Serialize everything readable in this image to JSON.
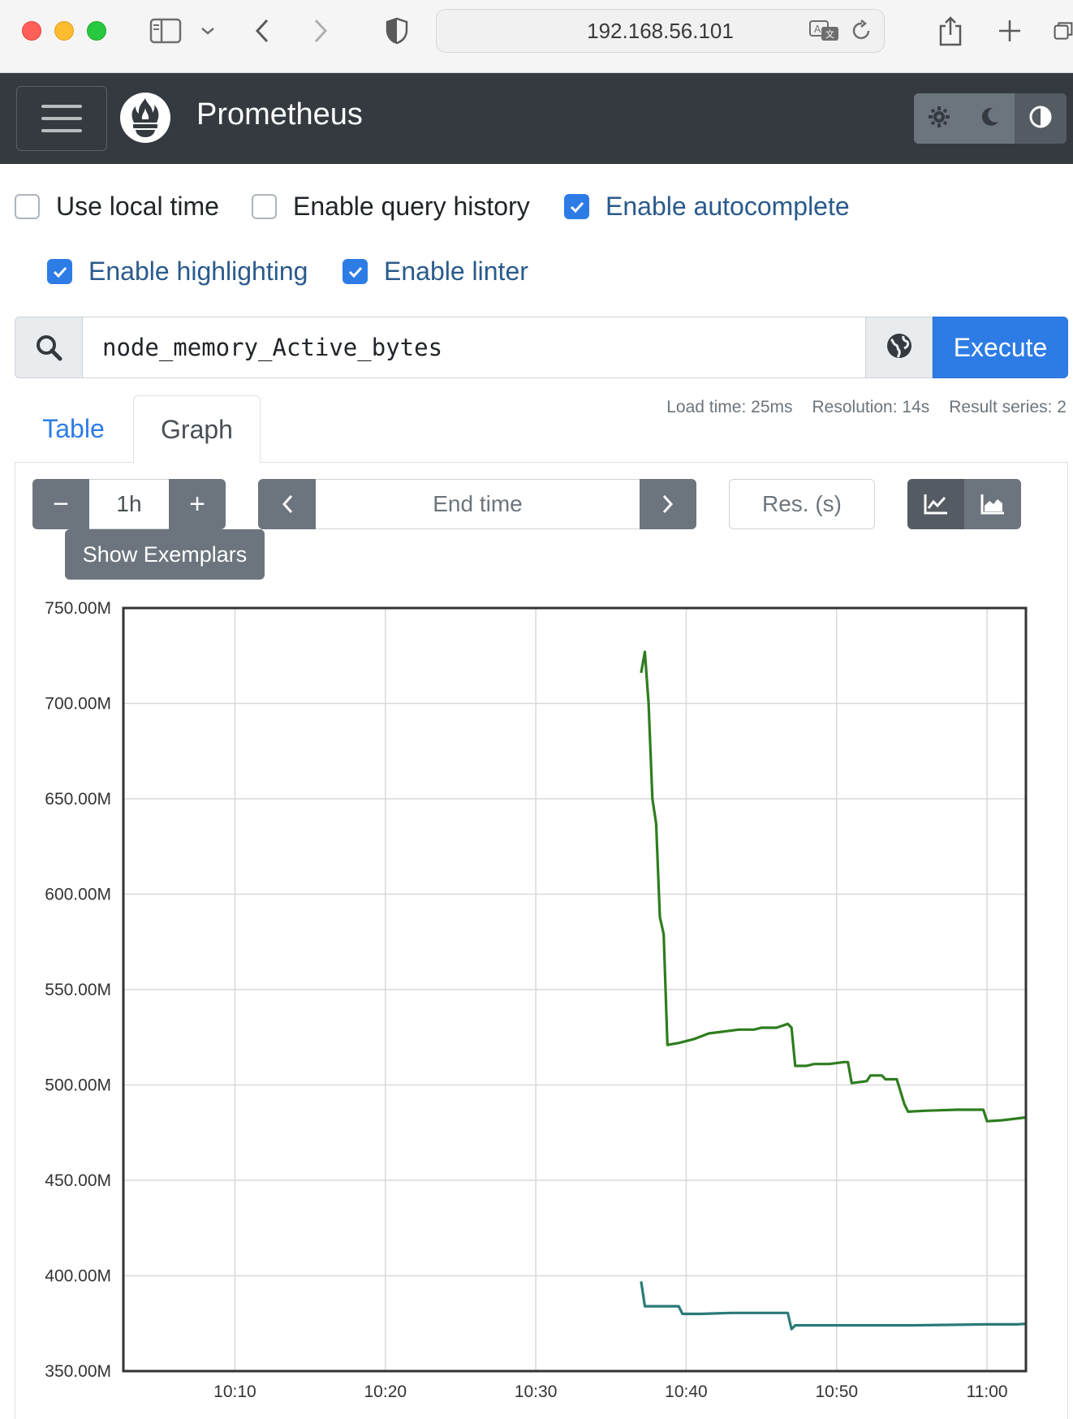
{
  "browser": {
    "url": "192.168.56.101",
    "icons": [
      "sidebar-icon",
      "chevron-down-icon",
      "back-icon",
      "forward-icon",
      "shield-icon",
      "translate-icon",
      "reload-icon",
      "share-icon",
      "new-tab-icon",
      "tabs-overview-icon"
    ]
  },
  "navbar": {
    "brand": "Prometheus",
    "theme_buttons": [
      "light-theme-icon",
      "dark-theme-icon",
      "auto-theme-icon"
    ],
    "active_theme": "auto"
  },
  "options": {
    "local_time": {
      "label": "Use local time",
      "checked": false
    },
    "query_history": {
      "label": "Enable query history",
      "checked": false
    },
    "autocomplete": {
      "label": "Enable autocomplete",
      "checked": true
    },
    "highlighting": {
      "label": "Enable highlighting",
      "checked": true
    },
    "linter": {
      "label": "Enable linter",
      "checked": true
    }
  },
  "query": {
    "expression": "node_memory_Active_bytes",
    "execute_label": "Execute"
  },
  "tabs": {
    "table": "Table",
    "graph": "Graph",
    "active": "Graph"
  },
  "stats": {
    "load_time": "Load time: 25ms",
    "resolution": "Resolution: 14s",
    "result_series": "Result series: 2"
  },
  "controls": {
    "range_minus": "−",
    "range_value": "1h",
    "range_plus": "+",
    "end_time_placeholder": "End time",
    "resolution_placeholder": "Res. (s)",
    "show_exemplars": "Show Exemplars",
    "chart_mode": "line"
  },
  "colors": {
    "navbar": "#343a40",
    "primary": "#2d7ce6",
    "series_1": "#2e7d1f",
    "series_2": "#2a7a78"
  },
  "chart_data": {
    "type": "line",
    "title": "",
    "xlabel": "",
    "ylabel": "",
    "ylim": [
      350000000,
      750000000
    ],
    "xlim": [
      "10:02:35",
      "11:02:35"
    ],
    "y_ticks": [
      "750.00M",
      "700.00M",
      "650.00M",
      "600.00M",
      "550.00M",
      "500.00M",
      "450.00M",
      "400.00M",
      "350.00M"
    ],
    "x_ticks": [
      "10:10",
      "10:20",
      "10:30",
      "10:40",
      "10:50",
      "11:00"
    ],
    "grid": true,
    "series": [
      {
        "color": "#2e7d1f",
        "points": [
          [
            "10:37:00",
            716000000
          ],
          [
            "10:37:15",
            727000000
          ],
          [
            "10:37:30",
            700000000
          ],
          [
            "10:37:45",
            650000000
          ],
          [
            "10:38:00",
            637000000
          ],
          [
            "10:38:15",
            588000000
          ],
          [
            "10:38:30",
            579000000
          ],
          [
            "10:38:45",
            521000000
          ],
          [
            "10:39:30",
            522000000
          ],
          [
            "10:40:30",
            524000000
          ],
          [
            "10:41:30",
            527000000
          ],
          [
            "10:42:30",
            528000000
          ],
          [
            "10:43:30",
            529000000
          ],
          [
            "10:44:30",
            529000000
          ],
          [
            "10:45:00",
            530000000
          ],
          [
            "10:46:00",
            530000000
          ],
          [
            "10:46:45",
            532000000
          ],
          [
            "10:47:00",
            530000000
          ],
          [
            "10:47:15",
            510000000
          ],
          [
            "10:48:00",
            510000000
          ],
          [
            "10:48:30",
            511000000
          ],
          [
            "10:49:30",
            511000000
          ],
          [
            "10:50:30",
            512000000
          ],
          [
            "10:50:45",
            512000000
          ],
          [
            "10:51:00",
            501000000
          ],
          [
            "10:52:00",
            502000000
          ],
          [
            "10:52:15",
            505000000
          ],
          [
            "10:53:00",
            505000000
          ],
          [
            "10:53:15",
            503000000
          ],
          [
            "10:54:00",
            503000000
          ],
          [
            "10:54:30",
            490000000
          ],
          [
            "10:54:45",
            486000000
          ],
          [
            "10:56:00",
            486500000
          ],
          [
            "10:58:00",
            487000000
          ],
          [
            "10:59:45",
            487000000
          ],
          [
            "11:00:00",
            481000000
          ],
          [
            "11:01:00",
            481500000
          ],
          [
            "11:02:35",
            483000000
          ]
        ]
      },
      {
        "color": "#2a7a78",
        "points": [
          [
            "10:37:00",
            397000000
          ],
          [
            "10:37:15",
            384000000
          ],
          [
            "10:38:00",
            384000000
          ],
          [
            "10:39:30",
            384000000
          ],
          [
            "10:39:45",
            380000000
          ],
          [
            "10:41:00",
            380000000
          ],
          [
            "10:43:00",
            380500000
          ],
          [
            "10:45:00",
            380500000
          ],
          [
            "10:46:45",
            380500000
          ],
          [
            "10:47:00",
            372000000
          ],
          [
            "10:47:15",
            374000000
          ],
          [
            "10:50:00",
            374000000
          ],
          [
            "10:55:00",
            374000000
          ],
          [
            "11:00:00",
            374500000
          ],
          [
            "11:02:00",
            374500000
          ],
          [
            "11:02:35",
            374800000
          ]
        ]
      }
    ]
  }
}
